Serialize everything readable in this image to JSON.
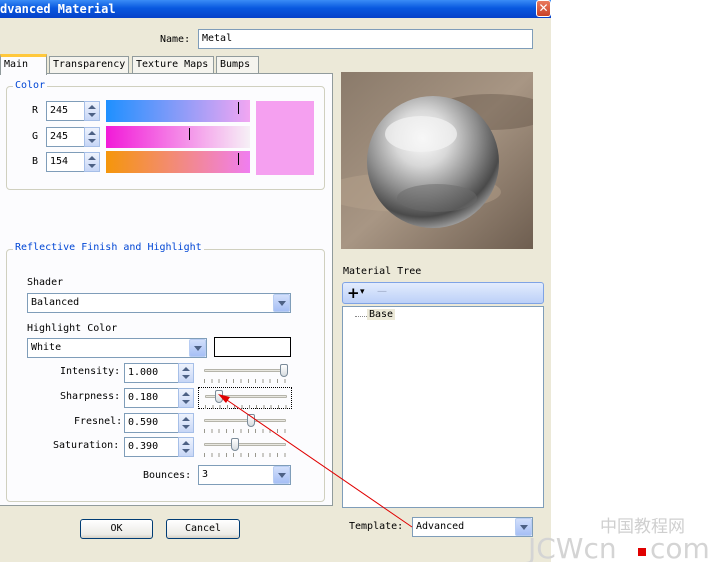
{
  "window": {
    "title": "dvanced Material",
    "close_glyph": "✕"
  },
  "name_label": "Name:",
  "name_value": "Metal",
  "tabs": [
    {
      "label": "Main",
      "active": true
    },
    {
      "label": "Transparency",
      "active": false
    },
    {
      "label": "Texture Maps",
      "active": false
    },
    {
      "label": "Bumps",
      "active": false
    }
  ],
  "color_group": {
    "title": "Color",
    "channels": [
      {
        "label": "R",
        "value": "245",
        "fraction": 0.96
      },
      {
        "label": "G",
        "value": "245",
        "fraction": 0.6
      },
      {
        "label": "B",
        "value": "154",
        "fraction": 0.96
      }
    ],
    "swatch_color": "#f5a0f0"
  },
  "reflective_group": {
    "title": "Reflective Finish and Highlight",
    "shader_label": "Shader",
    "shader_value": "Balanced",
    "highlight_color_label": "Highlight Color",
    "highlight_color_value": "White",
    "params": [
      {
        "label": "Intensity:",
        "value": "1.000",
        "fraction": 1.0
      },
      {
        "label": "Sharpness:",
        "value": "0.180",
        "fraction": 0.18
      },
      {
        "label": "Fresnel:",
        "value": "0.590",
        "fraction": 0.59
      },
      {
        "label": "Saturation:",
        "value": "0.390",
        "fraction": 0.39
      }
    ],
    "bounces_label": "Bounces:",
    "bounces_value": "3"
  },
  "buttons": {
    "ok": "OK",
    "cancel": "Cancel"
  },
  "material_tree": {
    "title": "Material Tree",
    "add_glyph": "+",
    "dropdown_glyph": "▾",
    "remove_glyph": "—",
    "items": [
      "Base"
    ]
  },
  "template_label": "Template:",
  "template_value": "Advanced",
  "watermark": {
    "chinese": "中国教程网",
    "latin_a": "JCWcn",
    "latin_b": "com"
  },
  "colors": {
    "accent": "#0046d5",
    "title_bar": "#0858df",
    "arrow": "#e00000"
  }
}
